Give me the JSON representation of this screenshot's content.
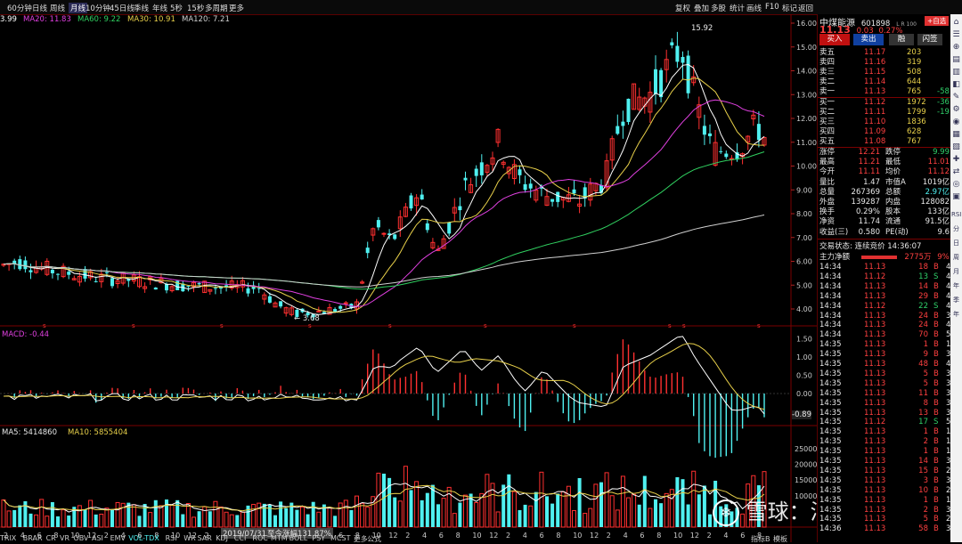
{
  "topbar": {
    "timeframes": [
      "60分钟",
      "日线",
      "周线",
      "月线",
      "10分钟",
      "45日线",
      "季线",
      "年线",
      "5秒",
      "15秒",
      "多周期",
      "更多"
    ],
    "active_index": 3,
    "right_items": [
      "复权",
      "叠加",
      "多股",
      "统计",
      "画线",
      "F10",
      "标记"
    ],
    "back_label": "返回"
  },
  "ma_legend": [
    {
      "label": "3.99",
      "color": "#ffffff"
    },
    {
      "label": "MA20: 11.83",
      "color": "#e040e0"
    },
    {
      "label": "MA60: 9.22",
      "color": "#30d060"
    },
    {
      "label": "MA30: 10.91",
      "color": "#e8d04a"
    },
    {
      "label": "MA120: 7.21",
      "color": "#d0d0d0"
    }
  ],
  "price_axis": [
    "16.00",
    "15.00",
    "14.00",
    "13.00",
    "12.00",
    "11.00",
    "10.00",
    "9.00",
    "8.00",
    "7.00",
    "6.00",
    "5.00",
    "4.00"
  ],
  "annotations": {
    "high": "15.92",
    "low": "3.68"
  },
  "macd": {
    "label": "MACD: -0.44",
    "axis": [
      "1.50",
      "1.00",
      "0.50",
      "0.00"
    ],
    "current": "-0.89"
  },
  "volume": {
    "ma5": "MA5: 5414860",
    "ma10": "MA10: 5855404",
    "axis": [
      "25000",
      "20000",
      "15000",
      "10000"
    ]
  },
  "x_axis_labels": [
    "2",
    "4",
    "6",
    "8",
    "10",
    "12",
    "2",
    "4",
    "6",
    "8",
    "10",
    "12",
    "2",
    "4",
    "6",
    "8",
    "10",
    "12",
    "2",
    "4",
    "6",
    "8",
    "10",
    "12",
    "2",
    "4",
    "6",
    "8",
    "10",
    "12",
    "2",
    "4",
    "6",
    "8",
    "10",
    "12",
    "2",
    "4",
    "6",
    "8",
    "10",
    "12",
    "2",
    "4",
    "6",
    "8"
  ],
  "date_tip": "2019/07/31/三",
  "range_tip": "至今涨幅131.87%",
  "indicator_tabs": [
    "TRIX",
    "BRAR",
    "CR",
    "VR",
    "OBV",
    "ASI",
    "EMV",
    "VOL-TDX",
    "RSI",
    "WR",
    "SAR",
    "KDJ",
    "CCI",
    "ROC",
    "MTM",
    "BOLL",
    "PSY",
    "MCST",
    "更多",
    "公式"
  ],
  "bottom_right_tabs": [
    "指标B",
    "模板"
  ],
  "watermark": "雪球：滇南王",
  "stock": {
    "name": "中煤能源",
    "code": "601898",
    "badge": "L R 100",
    "price": "11.13",
    "change": "0.03",
    "pct": "0.27%",
    "btn_add": "+自选"
  },
  "trade_buttons": [
    "买入",
    "卖出",
    "融",
    "闪签"
  ],
  "sell_orders": [
    {
      "label": "卖五",
      "price": "11.17",
      "vol": "203",
      "chg": ""
    },
    {
      "label": "卖四",
      "price": "11.16",
      "vol": "319",
      "chg": ""
    },
    {
      "label": "卖三",
      "price": "11.15",
      "vol": "508",
      "chg": ""
    },
    {
      "label": "卖二",
      "price": "11.14",
      "vol": "644",
      "chg": ""
    },
    {
      "label": "卖一",
      "price": "11.13",
      "vol": "765",
      "chg": "-58"
    }
  ],
  "buy_orders": [
    {
      "label": "买一",
      "price": "11.12",
      "vol": "1972",
      "chg": "-36"
    },
    {
      "label": "买二",
      "price": "11.11",
      "vol": "1799",
      "chg": "-19"
    },
    {
      "label": "买三",
      "price": "11.10",
      "vol": "1836",
      "chg": ""
    },
    {
      "label": "买四",
      "price": "11.09",
      "vol": "628",
      "chg": ""
    },
    {
      "label": "买五",
      "price": "11.08",
      "vol": "767",
      "chg": ""
    }
  ],
  "stats": [
    {
      "k1": "涨停",
      "v1": "12.21",
      "k2": "跌停",
      "v2": "9.99"
    },
    {
      "k1": "最高",
      "v1": "11.21",
      "k2": "最低",
      "v2": "11.01"
    },
    {
      "k1": "今开",
      "v1": "11.11",
      "k2": "均价",
      "v2": "11.12"
    },
    {
      "k1": "量比",
      "v1": "1.47",
      "k2": "市值A",
      "v2": "1019亿"
    },
    {
      "k1": "总量",
      "v1": "267369",
      "k2": "总额",
      "v2": "2.97亿"
    },
    {
      "k1": "外盘",
      "v1": "139287",
      "k2": "内盘",
      "v2": "128082"
    },
    {
      "k1": "换手",
      "v1": "0.29%",
      "k2": "股本",
      "v2": "133亿"
    },
    {
      "k1": "净资",
      "v1": "11.74",
      "k2": "流通",
      "v2": "91.5亿"
    },
    {
      "k1": "收益(三)",
      "v1": "0.580",
      "k2": "PE(动)",
      "v2": "9.6"
    }
  ],
  "trade_status": "交易状态: 连续竞价 14:36:07",
  "net_inflow": {
    "label": "主力净额",
    "value": "2775万",
    "pct": "9%"
  },
  "ticks": [
    {
      "t": "14:34",
      "p": "11.13",
      "v": "18",
      "s": "B",
      "n": "4"
    },
    {
      "t": "14:34",
      "p": "11.12",
      "v": "13",
      "s": "S",
      "n": "4"
    },
    {
      "t": "14:34",
      "p": "11.13",
      "v": "14",
      "s": "B",
      "n": "4"
    },
    {
      "t": "14:34",
      "p": "11.13",
      "v": "29",
      "s": "B",
      "n": "4"
    },
    {
      "t": "14:34",
      "p": "11.12",
      "v": "22",
      "s": "S",
      "n": "4"
    },
    {
      "t": "14:34",
      "p": "11.13",
      "v": "24",
      "s": "B",
      "n": "3"
    },
    {
      "t": "14:34",
      "p": "11.13",
      "v": "24",
      "s": "B",
      "n": "4"
    },
    {
      "t": "14:34",
      "p": "11.13",
      "v": "70",
      "s": "B",
      "n": "5"
    },
    {
      "t": "14:35",
      "p": "11.13",
      "v": "1",
      "s": "B",
      "n": "1"
    },
    {
      "t": "14:35",
      "p": "11.13",
      "v": "9",
      "s": "B",
      "n": "3"
    },
    {
      "t": "14:35",
      "p": "11.13",
      "v": "48",
      "s": "B",
      "n": "4"
    },
    {
      "t": "14:35",
      "p": "11.13",
      "v": "5",
      "s": "B",
      "n": "3"
    },
    {
      "t": "14:35",
      "p": "11.13",
      "v": "5",
      "s": "B",
      "n": "3"
    },
    {
      "t": "14:35",
      "p": "11.13",
      "v": "11",
      "s": "B",
      "n": "3"
    },
    {
      "t": "14:35",
      "p": "11.13",
      "v": "8",
      "s": "B",
      "n": "3"
    },
    {
      "t": "14:35",
      "p": "11.13",
      "v": "13",
      "s": "B",
      "n": "3"
    },
    {
      "t": "14:35",
      "p": "11.12",
      "v": "17",
      "s": "S",
      "n": "5"
    },
    {
      "t": "14:35",
      "p": "11.13",
      "v": "1",
      "s": "B",
      "n": "1"
    },
    {
      "t": "14:35",
      "p": "11.13",
      "v": "2",
      "s": "B",
      "n": "1"
    },
    {
      "t": "14:35",
      "p": "11.13",
      "v": "1",
      "s": "B",
      "n": "1"
    },
    {
      "t": "14:35",
      "p": "11.13",
      "v": "14",
      "s": "B",
      "n": "3"
    },
    {
      "t": "14:35",
      "p": "11.13",
      "v": "15",
      "s": "B",
      "n": "2"
    },
    {
      "t": "14:35",
      "p": "11.13",
      "v": "3",
      "s": "B",
      "n": "3"
    },
    {
      "t": "14:35",
      "p": "11.13",
      "v": "10",
      "s": "B",
      "n": "2"
    },
    {
      "t": "14:35",
      "p": "11.13",
      "v": "1",
      "s": "B",
      "n": "1"
    },
    {
      "t": "14:35",
      "p": "11.13",
      "v": "2",
      "s": "B",
      "n": "3"
    },
    {
      "t": "14:35",
      "p": "11.13",
      "v": "5",
      "s": "B",
      "n": "2"
    },
    {
      "t": "14:36",
      "p": "11.13",
      "v": "58",
      "s": "B",
      "n": "3"
    }
  ],
  "sidebar_labels": [
    "RSI",
    "分",
    "日",
    "周",
    "月",
    "年",
    "季",
    "年"
  ],
  "colors": {
    "up": "#ff3030",
    "down": "#4ff0f0",
    "ma5": "#ffffff",
    "ma10": "#e8d04a",
    "ma20": "#e040e0",
    "ma60": "#30d060",
    "ma120": "#d0d0d0"
  }
}
